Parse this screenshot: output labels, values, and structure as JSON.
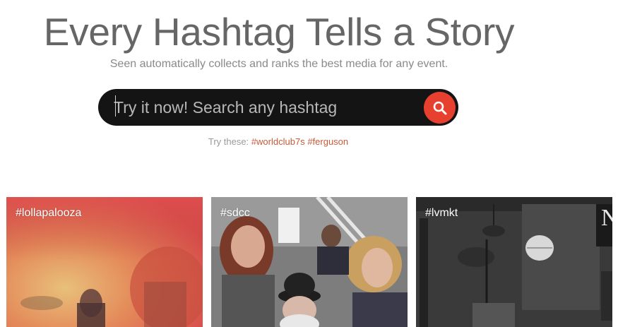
{
  "hero": {
    "title": "Every Hashtag Tells a Story",
    "subtitle": "Seen automatically collects and ranks the best media for any event."
  },
  "search": {
    "placeholder": "Try it now! Search any hashtag",
    "icon": "search-icon",
    "button_color": "#e8402f"
  },
  "suggestions": {
    "prefix": "Try these:",
    "items": [
      "#worldclub7s",
      "#ferguson"
    ],
    "link_color": "#c75a3a"
  },
  "tiles": [
    {
      "label": "#lollapalooza"
    },
    {
      "label": "#sdcc"
    },
    {
      "label": "#lvmkt"
    }
  ]
}
